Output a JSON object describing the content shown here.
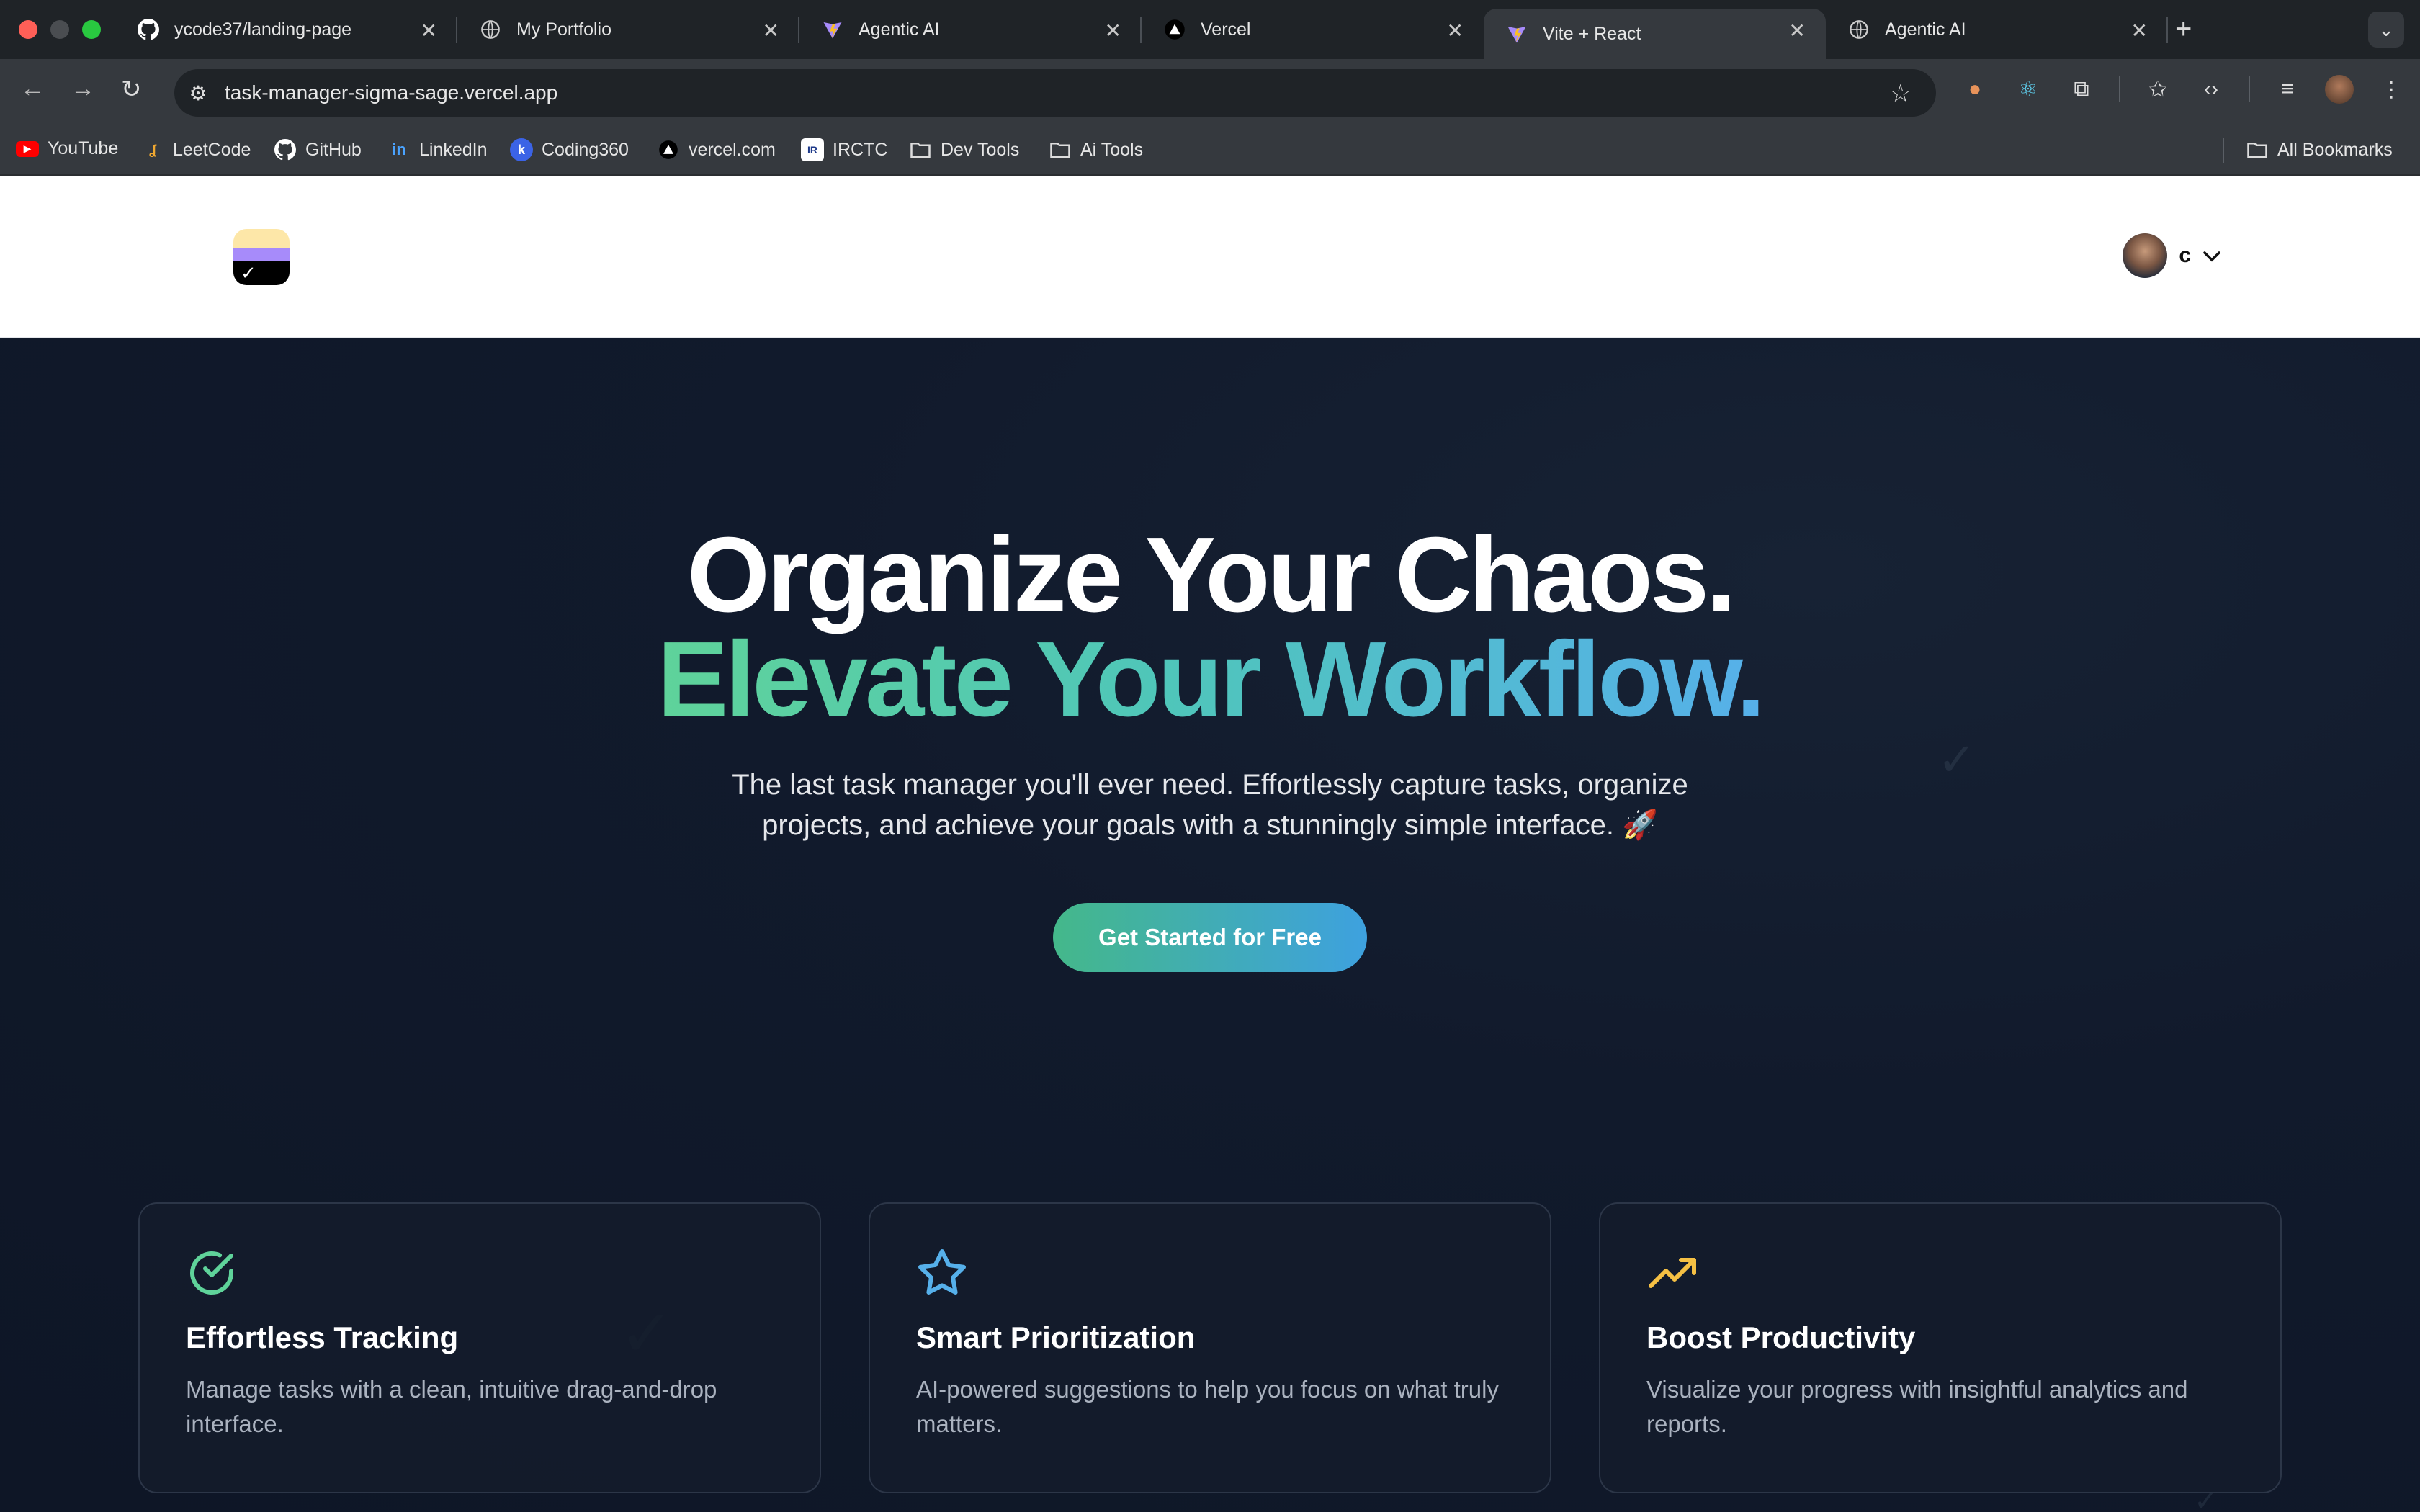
{
  "browser": {
    "tabs": [
      {
        "title": "ycode37/landing-page",
        "icon": "github-icon"
      },
      {
        "title": "My Portfolio",
        "icon": "globe-icon"
      },
      {
        "title": "Agentic AI",
        "icon": "vite-icon"
      },
      {
        "title": "Vercel",
        "icon": "vercel-icon"
      },
      {
        "title": "Vite + React",
        "icon": "vite-icon",
        "active": true
      },
      {
        "title": "Agentic AI",
        "icon": "globe-icon"
      }
    ],
    "url": "task-manager-sigma-sage.vercel.app",
    "bookmarks": [
      {
        "label": "YouTube"
      },
      {
        "label": "LeetCode"
      },
      {
        "label": "GitHub"
      },
      {
        "label": "LinkedIn"
      },
      {
        "label": "Coding360"
      },
      {
        "label": "vercel.com"
      },
      {
        "label": "IRCTC"
      },
      {
        "label": "Dev Tools"
      },
      {
        "label": "Ai Tools"
      }
    ],
    "all_bookmarks": "All Bookmarks"
  },
  "header": {
    "user_initial": "c"
  },
  "hero": {
    "headline_line1": "Organize Your Chaos.",
    "headline_line2": "Elevate Your Workflow.",
    "subtitle": "The last task manager you'll ever need. Effortlessly capture tasks, organize projects, and achieve your goals with a stunningly simple interface. 🚀",
    "cta_label": "Get Started for Free"
  },
  "features": [
    {
      "title": "Effortless Tracking",
      "description": "Manage tasks with a clean, intuitive drag-and-drop interface.",
      "icon": "check-circle-icon",
      "color": "#5fd39a"
    },
    {
      "title": "Smart Prioritization",
      "description": "AI-powered suggestions to help you focus on what truly matters.",
      "icon": "star-icon",
      "color": "#56b0ea"
    },
    {
      "title": "Boost Productivity",
      "description": "Visualize your progress with insightful analytics and reports.",
      "icon": "trending-up-icon",
      "color": "#f5c044"
    }
  ],
  "colors": {
    "accent_green": "#5fd39a",
    "accent_blue": "#56b0ea",
    "background": "#0f172a"
  }
}
